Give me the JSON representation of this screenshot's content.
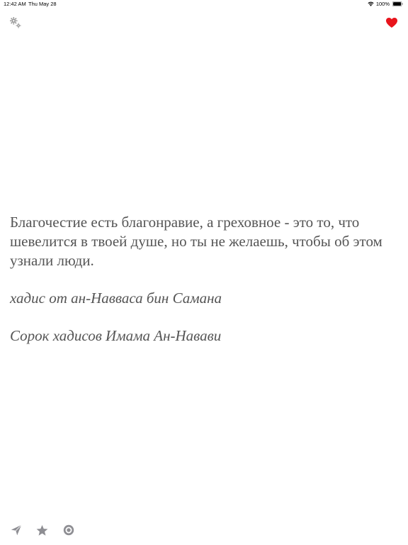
{
  "status_bar": {
    "time": "12:42 AM",
    "date": "Thu May 28",
    "battery": "100%"
  },
  "toolbar": {
    "settings_icon": "gears-icon",
    "favorite_icon": "heart-icon",
    "favorite_color": "#e8141c"
  },
  "quote": {
    "text": "Благочестие есть благонравие, а греховное - это то, что шевелится в твоей душе, но ты не желаешь, чтобы об этом узнали люди.",
    "narrator": "хадис от ан-Навваса бин Самана",
    "source": "Сорок хадисов Имама Ан-Навави",
    "text_color": "#555555"
  },
  "bottom_bar": {
    "share_icon": "send-icon",
    "star_icon": "star-icon",
    "record_icon": "target-icon",
    "icon_color": "#8e8e93"
  }
}
